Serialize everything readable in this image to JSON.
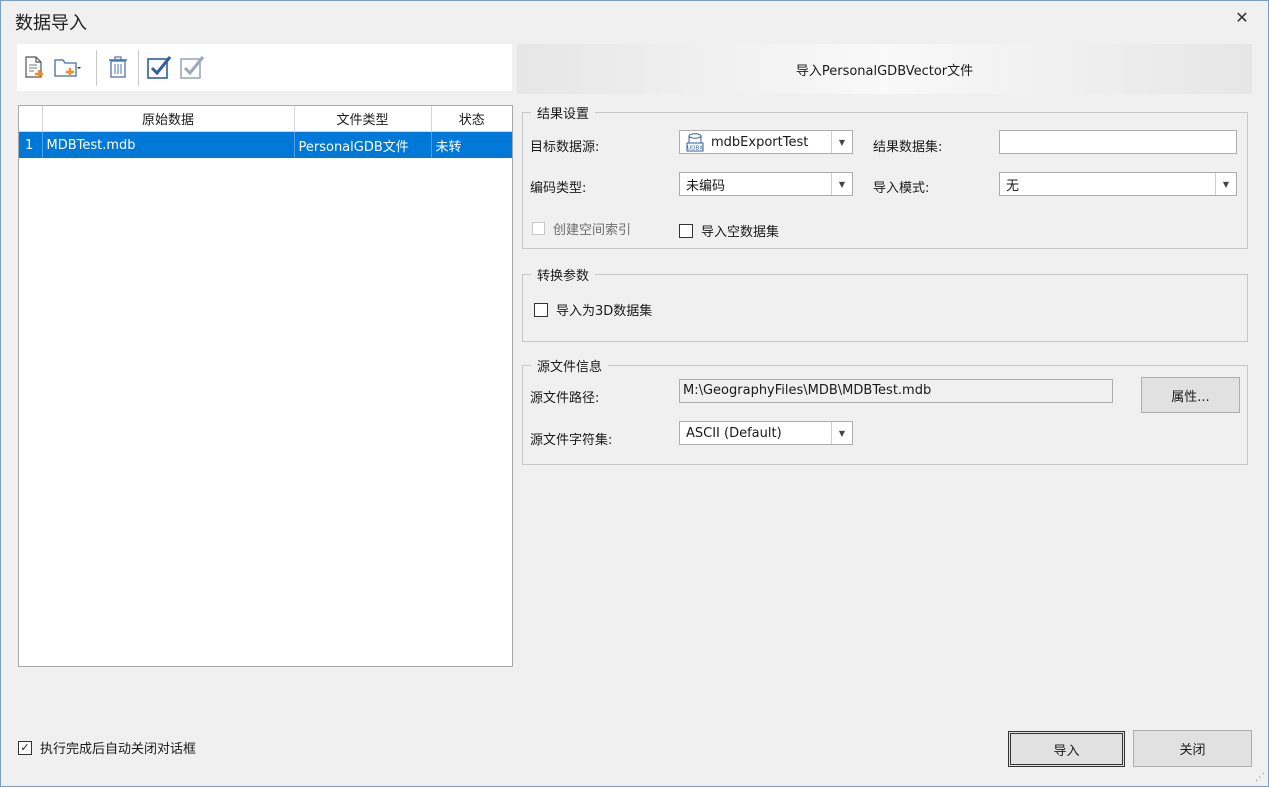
{
  "window": {
    "title": "数据导入",
    "close_glyph": "✕"
  },
  "toolbar": {
    "items": [
      {
        "name": "add-file-icon"
      },
      {
        "name": "add-folder-icon"
      },
      {
        "name": "delete-icon"
      },
      {
        "name": "select-all-icon"
      },
      {
        "name": "invert-select-icon"
      }
    ]
  },
  "banner": {
    "text": "导入PersonalGDBVector文件"
  },
  "file_grid": {
    "columns": [
      "",
      "原始数据",
      "文件类型",
      "状态"
    ],
    "rows": [
      {
        "index": "1",
        "source": "MDBTest.mdb",
        "type": "PersonalGDB文件",
        "status": "未转"
      }
    ]
  },
  "result_settings": {
    "legend": "结果设置",
    "target_datasource_label": "目标数据源:",
    "target_datasource_value": "mdbExportTest",
    "target_datasource_icon": "UDBX",
    "result_dataset_label": "结果数据集:",
    "result_dataset_value": "",
    "encoding_label": "编码类型:",
    "encoding_value": "未编码",
    "import_mode_label": "导入模式:",
    "import_mode_value": "无",
    "spatial_index_label": "创建空间索引",
    "spatial_index_checked": false,
    "import_empty_label": "导入空数据集",
    "import_empty_checked": false
  },
  "conversion": {
    "legend": "转换参数",
    "import_3d_label": "导入为3D数据集",
    "import_3d_checked": false
  },
  "source_info": {
    "legend": "源文件信息",
    "path_label": "源文件路径:",
    "path_value": "M:\\GeographyFiles\\MDB\\MDBTest.mdb",
    "properties_button": "属性...",
    "charset_label": "源文件字符集:",
    "charset_value": "ASCII (Default)"
  },
  "footer": {
    "auto_close_label": "执行完成后自动关闭对话框",
    "auto_close_checked": true,
    "check_glyph": "✓",
    "import_button": "导入",
    "close_button": "关闭"
  }
}
